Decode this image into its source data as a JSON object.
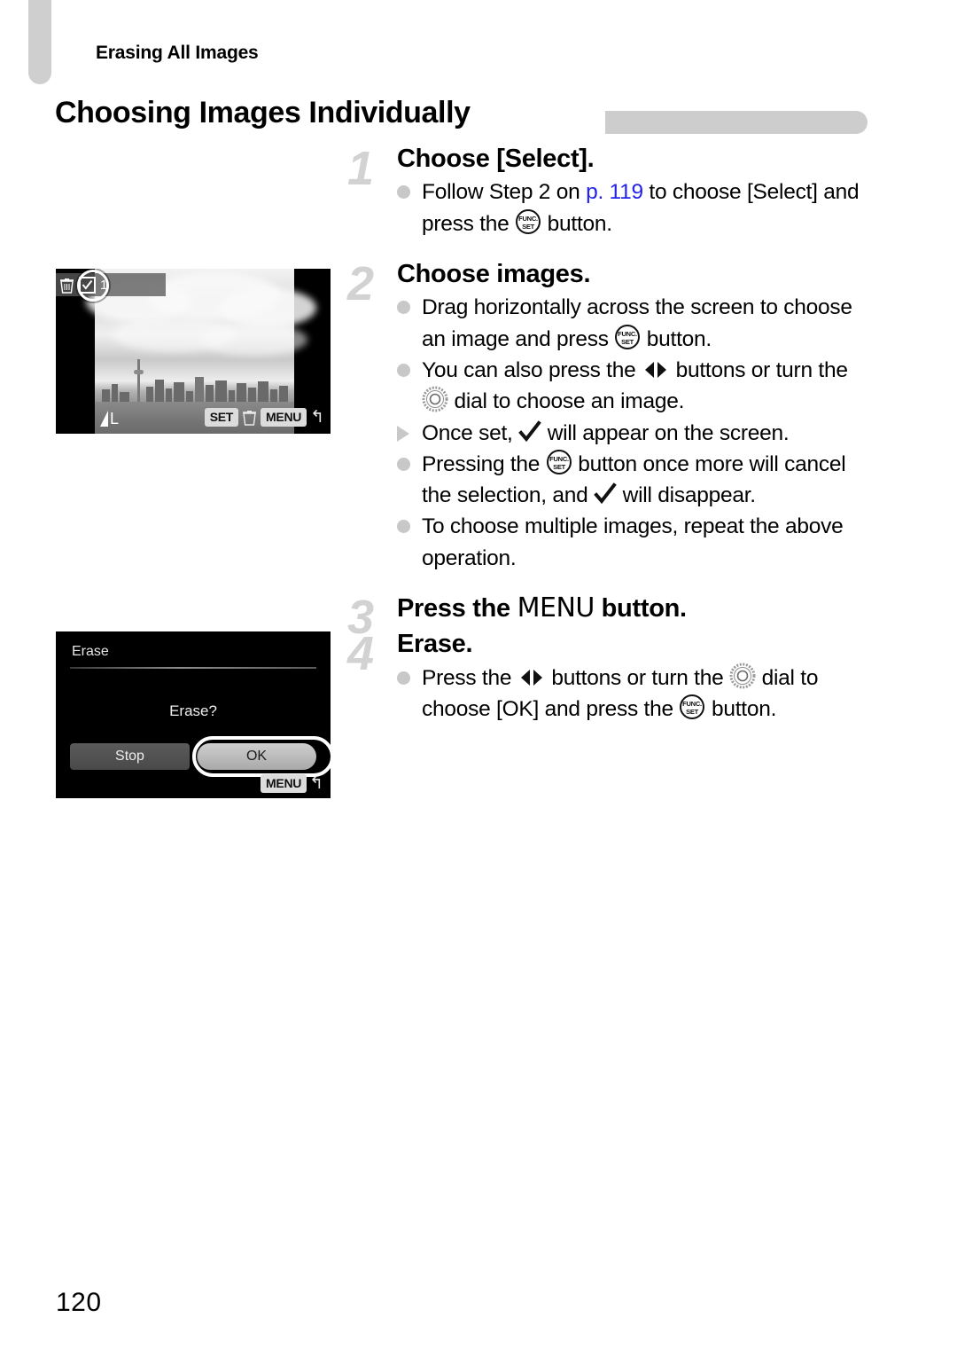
{
  "page": {
    "running_head": "Erasing All Images",
    "section_title": "Choosing Images Individually",
    "folio": "120"
  },
  "steps": [
    {
      "number": "1",
      "heading": "Choose [Select].",
      "bullets": [
        {
          "marker": "dot",
          "parts": [
            {
              "t": "text",
              "v": "Follow Step 2 on "
            },
            {
              "t": "link",
              "v": "p. 119"
            },
            {
              "t": "text",
              "v": " to choose [Select] and press the "
            },
            {
              "t": "icon",
              "v": "func-set-icon"
            },
            {
              "t": "text",
              "v": " button."
            }
          ],
          "line1": "Follow Step 2 on ",
          "link": "p. 119",
          "line1b": " to choose [Select]",
          "line2a": "and press the ",
          "line2b": " button."
        }
      ]
    },
    {
      "number": "2",
      "heading": "Choose images.",
      "bullets": [
        {
          "marker": "dot",
          "a": "Drag horizontally across the screen to choose an image and press ",
          "b": " button."
        },
        {
          "marker": "dot",
          "a": "You can also press the ",
          "b": " buttons or turn the ",
          "c": " dial to choose an image."
        },
        {
          "marker": "triangle",
          "a": "Once set, ",
          "b": " will appear on the screen."
        },
        {
          "marker": "dot",
          "a": "Pressing the ",
          "b": " button once more will cancel the selection, and ",
          "c": " will disappear."
        },
        {
          "marker": "dot",
          "a": "To choose multiple images, repeat the above operation."
        }
      ]
    },
    {
      "number": "3",
      "heading_a": "Press the ",
      "heading_menu": "MENU",
      "heading_b": " button."
    },
    {
      "number": "4",
      "heading": "Erase.",
      "bullets": [
        {
          "marker": "dot",
          "a": "Press the ",
          "b": " buttons or turn the ",
          "c": " dial to choose [OK] and press the ",
          "d": " button."
        }
      ]
    }
  ],
  "screens": {
    "select": {
      "name": "image-select-screen",
      "badge_count": "1",
      "quality_label": "L",
      "key_set": "SET",
      "key_menu": "MENU",
      "back_glyph": "↰",
      "icons": [
        "trash-icon",
        "checkmark-box-icon"
      ]
    },
    "erase_dialog": {
      "name": "erase-confirm-screen",
      "title": "Erase",
      "message": "Erase?",
      "button_stop": "Stop",
      "button_ok": "OK",
      "selected": "OK",
      "key_menu": "MENU",
      "back_glyph": "↰"
    }
  },
  "colors": {
    "link": "#2222e8",
    "step_number": "#d2d2d2",
    "bullet": "#c8c8c8",
    "tab": "#cfcfcf",
    "rule": "#cdcdcd"
  }
}
